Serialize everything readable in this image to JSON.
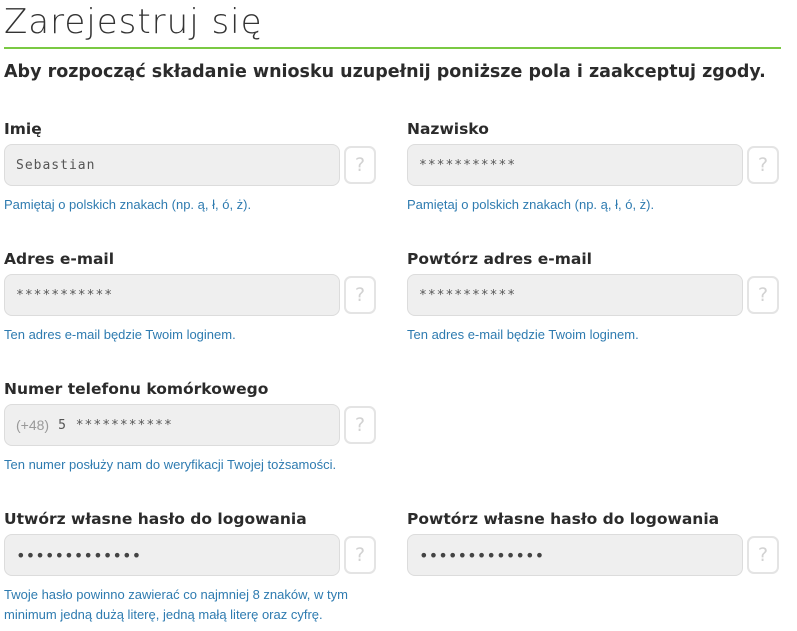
{
  "header": {
    "title": "Zarejestruj się",
    "subtitle": "Aby rozpocząć składanie wniosku uzupełnij poniższe pola i zaakceptuj zgody."
  },
  "form": {
    "first_name": {
      "label": "Imię",
      "value": "Sebastian",
      "hint": "Pamiętaj o polskich znakach (np. ą, ł, ó, ż).",
      "help": "?"
    },
    "last_name": {
      "label": "Nazwisko",
      "value": "***********",
      "hint": "Pamiętaj o polskich znakach (np. ą, ł, ó, ż).",
      "help": "?"
    },
    "email": {
      "label": "Adres e-mail",
      "value": "***********",
      "hint": "Ten adres e-mail będzie Twoim loginem.",
      "help": "?"
    },
    "email_repeat": {
      "label": "Powtórz adres e-mail",
      "value": "***********",
      "hint": "Ten adres e-mail będzie Twoim loginem.",
      "help": "?"
    },
    "phone": {
      "label": "Numer telefonu komórkowego",
      "prefix": "(+48)",
      "value": "5 ***********",
      "hint": "Ten numer posłuży nam do weryfikacji Twojej tożsamości.",
      "help": "?"
    },
    "password": {
      "label": "Utwórz własne hasło do logowania",
      "value": "•••••••••••••",
      "hint": "Twoje hasło powinno zawierać co najmniej 8 znaków, w tym minimum jedną dużą literę, jedną małą literę oraz cyfrę.",
      "help": "?"
    },
    "password_repeat": {
      "label": "Powtórz własne hasło do logowania",
      "value": "•••••••••••••",
      "help": "?"
    }
  },
  "colors": {
    "accent_rule": "#7ac943",
    "hint_text": "#2e7bb0",
    "input_bg": "#efefef"
  },
  "icons": {
    "help": "question-mark-icon"
  }
}
